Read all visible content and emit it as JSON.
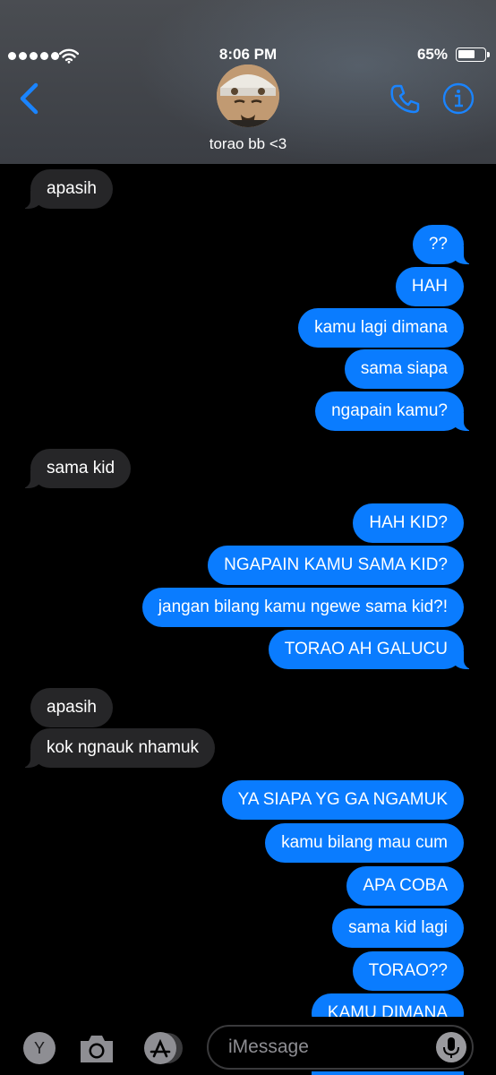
{
  "status_bar": {
    "time": "8:06 PM",
    "battery": "65%"
  },
  "header": {
    "contact_name": "torao bb <3"
  },
  "messages": [
    {
      "text": "apasih",
      "from": "them"
    },
    {
      "text": "??",
      "from": "me"
    },
    {
      "text": "HAH",
      "from": "me"
    },
    {
      "text": "kamu lagi dimana",
      "from": "me"
    },
    {
      "text": "sama siapa",
      "from": "me"
    },
    {
      "text": "ngapain kamu?",
      "from": "me"
    },
    {
      "text": "sama kid",
      "from": "them"
    },
    {
      "text": "HAH KID?",
      "from": "me"
    },
    {
      "text": "NGAPAIN KAMU SAMA KID?",
      "from": "me"
    },
    {
      "text": "jangan bilang kamu ngewe sama kid?!",
      "from": "me"
    },
    {
      "text": "TORAO AH GALUCU",
      "from": "me"
    },
    {
      "text": "apasih",
      "from": "them"
    },
    {
      "text": "kok ngnauk nhamuk",
      "from": "them"
    },
    {
      "text": "YA SIAPA YG GA NGAMUK",
      "from": "me"
    },
    {
      "text": "kamu bilang mau cum",
      "from": "me"
    },
    {
      "text": "APA COBA",
      "from": "me"
    },
    {
      "text": "sama kid lagi",
      "from": "me"
    },
    {
      "text": "TORAO??",
      "from": "me"
    },
    {
      "text": "KAMU DIMANA",
      "from": "me"
    }
  ],
  "input": {
    "placeholder": "iMessage",
    "apps_button_label": "Y"
  },
  "colors": {
    "outgoing": "#0a7cff",
    "incoming": "#262628",
    "accent": "#1a84ff"
  },
  "icons": [
    "back-icon",
    "phone-icon",
    "info-icon",
    "camera-icon",
    "appstore-icon",
    "mic-icon",
    "wifi-icon",
    "battery-icon"
  ]
}
